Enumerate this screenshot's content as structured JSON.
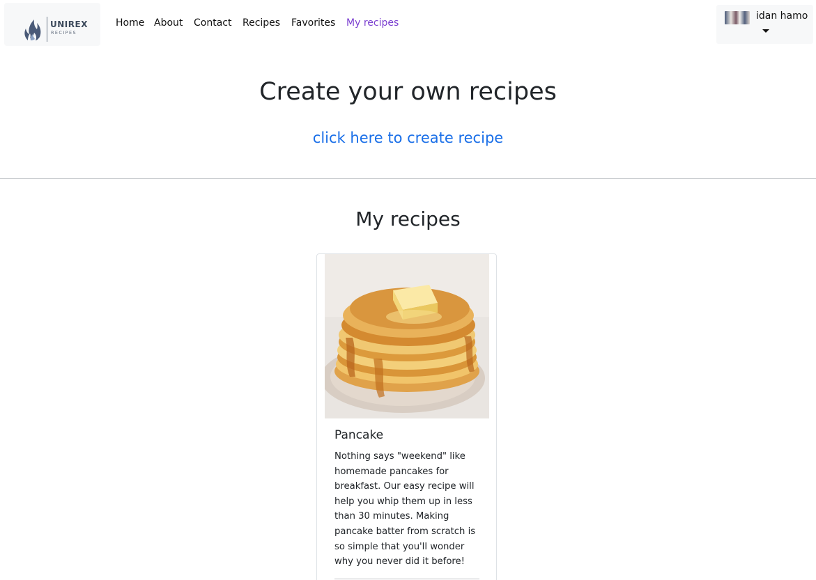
{
  "brand": {
    "name": "UNIREX",
    "tagline": "RECIPES"
  },
  "nav": {
    "items": [
      {
        "label": "Home",
        "active": false
      },
      {
        "label": "About",
        "active": false
      },
      {
        "label": "Contact",
        "active": false
      },
      {
        "label": "Recipes",
        "active": false
      },
      {
        "label": "Favorites",
        "active": false
      },
      {
        "label": "My recipes",
        "active": true
      }
    ],
    "active_color": "#7b3fd0"
  },
  "user": {
    "name": "idan hamo",
    "icon": "chevron-down-icon"
  },
  "hero": {
    "title": "Create your own recipes",
    "create_link": "click here to create recipe",
    "link_color": "#1a6fe8"
  },
  "section": {
    "title": "My recipes"
  },
  "recipes": [
    {
      "title": "Pancake",
      "description": "Nothing says \"weekend\" like homemade pancakes for breakfast. Our easy recipe will help you whip them up in less than 30 minutes. Making pancake batter from scratch is so simple that you'll wonder why you never did it before!"
    }
  ]
}
